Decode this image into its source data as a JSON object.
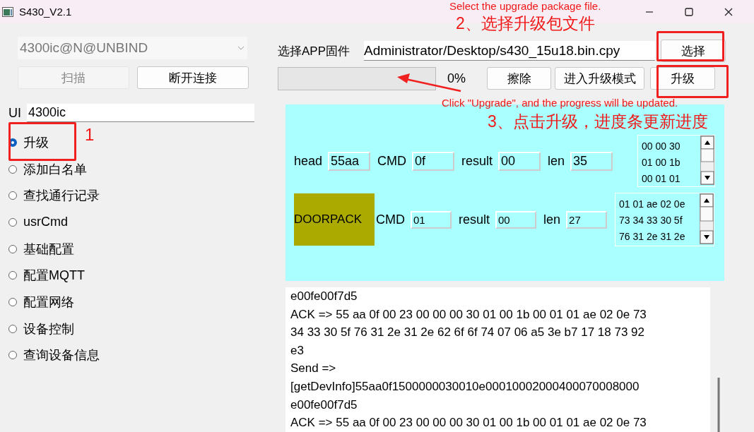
{
  "window": {
    "title": "S430_V2.1"
  },
  "device_select": {
    "value": "4300ic@N@UNBIND"
  },
  "connection_buttons": [
    {
      "label": "扫描",
      "disabled": true
    },
    {
      "label": "断开连接",
      "disabled": false
    }
  ],
  "ui_field": {
    "label": "UI",
    "value": "4300ic"
  },
  "functions": [
    {
      "label": "升级",
      "selected": true
    },
    {
      "label": "添加白名单",
      "selected": false
    },
    {
      "label": "查找通行记录",
      "selected": false
    },
    {
      "label": "usrCmd",
      "selected": false
    },
    {
      "label": "基础配置",
      "selected": false
    },
    {
      "label": "配置MQTT",
      "selected": false
    },
    {
      "label": "配置网络",
      "selected": false
    },
    {
      "label": "设备控制",
      "selected": false
    },
    {
      "label": "查询设备信息",
      "selected": false
    }
  ],
  "firmware": {
    "label": "选择APP固件",
    "path": "Administrator/Desktop/s430_15u18.bin.cpy",
    "choose_button": "选择"
  },
  "progress": {
    "level": 0,
    "reading": "0%"
  },
  "action_buttons": [
    "擦除",
    "进入升级模式",
    "升级"
  ],
  "packet": {
    "fields": [
      {
        "label": "head",
        "value": "55aa"
      },
      {
        "label": "CMD",
        "value": "0f"
      },
      {
        "label": "result",
        "value": "00"
      },
      {
        "label": "len",
        "value": "35"
      }
    ],
    "data_lines": [
      "00 00 30",
      "01 00 1b",
      "00 01 01"
    ]
  },
  "doorpack": {
    "title": "DOORPACK",
    "fields": [
      {
        "label": "CMD",
        "value": "01"
      },
      {
        "label": "result",
        "value": "00"
      },
      {
        "label": "len",
        "value": "27"
      }
    ],
    "data_lines": [
      "01 01 ae 02 0e",
      "73 34 33 30 5f",
      "76 31 2e 31 2e"
    ]
  },
  "log": [
    "e00fe00f7d5",
    "ACK => 55 aa 0f 00 23 00 00 00 30 01 00 1b 00 01 01 ae 02 0e 73",
    "34 33 30 5f 76 31 2e 31 2e 62 6f 6f 74 07 06 a5 3e b7 17 18 73 92",
    "e3",
    "Send =>",
    "[getDevInfo]55aa0f1500000030010e00010002000400070008000",
    "e00fe00f7d5",
    "ACK => 55 aa 0f 00 23 00 00 00 30 01 00 1b 00 01 01 ae 02 0e 73"
  ],
  "annotations": {
    "step_1": "1",
    "step_2_en": "Select the upgrade package file.",
    "step_2_zh": "2、选择升级包文件",
    "step_3_en": "Click \"Upgrade\", and the progress will be updated.",
    "step_3_zh": "3、点击升级，进度条更新进度"
  }
}
